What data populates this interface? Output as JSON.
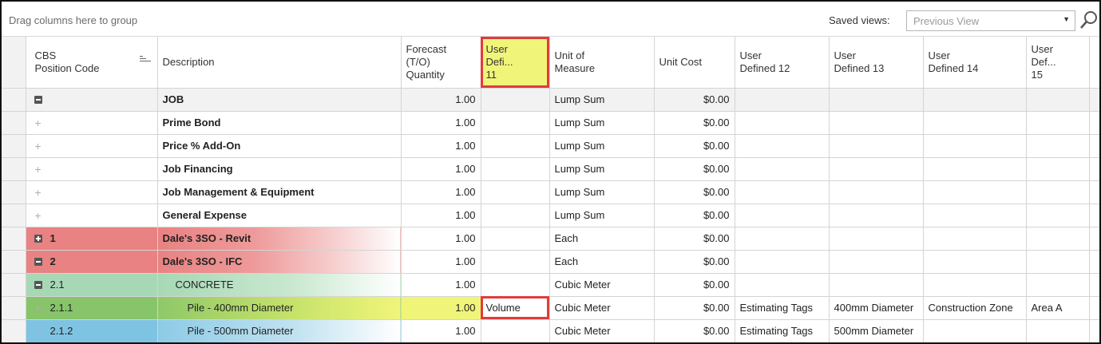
{
  "toolbar": {
    "group_hint": "Drag columns here to group",
    "saved_views_label": "Saved views:",
    "saved_views_value": "Previous View"
  },
  "columns": {
    "cbs_line1": "CBS",
    "cbs_line2": "Position Code",
    "description": "Description",
    "forecast_line1": "Forecast",
    "forecast_line2": "(T/O)",
    "forecast_line3": "Quantity",
    "ud11_line1": "User",
    "ud11_line2": "Defi...",
    "ud11_line3": "11",
    "uom_line1": "Unit of",
    "uom_line2": "Measure",
    "unit_cost": "Unit Cost",
    "ud12_line1": "User",
    "ud12_line2": "Defined 12",
    "ud13_line1": "User",
    "ud13_line2": "Defined 13",
    "ud14_line1": "User",
    "ud14_line2": "Defined 14",
    "ud15_line1": "User",
    "ud15_line2": "Def...",
    "ud15_line3": "15"
  },
  "rows": [
    {
      "code": "",
      "description": "JOB",
      "forecast": "1.00",
      "ud11": "",
      "uom": "Lump Sum",
      "unit_cost": "$0.00",
      "ud12": "",
      "ud13": "",
      "ud14": "",
      "ud15": ""
    },
    {
      "code": "",
      "description": "Prime Bond",
      "forecast": "1.00",
      "ud11": "",
      "uom": "Lump Sum",
      "unit_cost": "$0.00",
      "ud12": "",
      "ud13": "",
      "ud14": "",
      "ud15": ""
    },
    {
      "code": "",
      "description": "Price % Add-On",
      "forecast": "1.00",
      "ud11": "",
      "uom": "Lump Sum",
      "unit_cost": "$0.00",
      "ud12": "",
      "ud13": "",
      "ud14": "",
      "ud15": ""
    },
    {
      "code": "",
      "description": "Job Financing",
      "forecast": "1.00",
      "ud11": "",
      "uom": "Lump Sum",
      "unit_cost": "$0.00",
      "ud12": "",
      "ud13": "",
      "ud14": "",
      "ud15": ""
    },
    {
      "code": "",
      "description": "Job Management & Equipment",
      "forecast": "1.00",
      "ud11": "",
      "uom": "Lump Sum",
      "unit_cost": "$0.00",
      "ud12": "",
      "ud13": "",
      "ud14": "",
      "ud15": ""
    },
    {
      "code": "",
      "description": "General Expense",
      "forecast": "1.00",
      "ud11": "",
      "uom": "Lump Sum",
      "unit_cost": "$0.00",
      "ud12": "",
      "ud13": "",
      "ud14": "",
      "ud15": ""
    },
    {
      "code": "1",
      "description": "Dale's 3SO - Revit",
      "forecast": "1.00",
      "ud11": "",
      "uom": "Each",
      "unit_cost": "$0.00",
      "ud12": "",
      "ud13": "",
      "ud14": "",
      "ud15": ""
    },
    {
      "code": "2",
      "description": "Dale's 3SO - IFC",
      "forecast": "1.00",
      "ud11": "",
      "uom": "Each",
      "unit_cost": "$0.00",
      "ud12": "",
      "ud13": "",
      "ud14": "",
      "ud15": ""
    },
    {
      "code": "2.1",
      "description": "CONCRETE",
      "forecast": "1.00",
      "ud11": "",
      "uom": "Cubic Meter",
      "unit_cost": "$0.00",
      "ud12": "",
      "ud13": "",
      "ud14": "",
      "ud15": ""
    },
    {
      "code": "2.1.1",
      "description": "Pile - 400mm Diameter",
      "forecast": "1.00",
      "ud11": "Volume",
      "uom": "Cubic Meter",
      "unit_cost": "$0.00",
      "ud12": "Estimating Tags",
      "ud13": "400mm Diameter",
      "ud14": "Construction Zone",
      "ud15": "Area A"
    },
    {
      "code": "2.1.2",
      "description": "Pile - 500mm Diameter",
      "forecast": "1.00",
      "ud11": "",
      "uom": "Cubic Meter",
      "unit_cost": "$0.00",
      "ud12": "Estimating Tags",
      "ud13": "500mm Diameter",
      "ud14": "",
      "ud15": ""
    }
  ]
}
